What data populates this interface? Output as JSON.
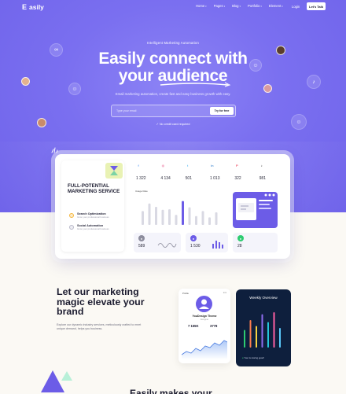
{
  "nav": {
    "logo": "asily",
    "logo_mark": "E",
    "menu": [
      {
        "label": "Home"
      },
      {
        "label": "Pages"
      },
      {
        "label": "Blog"
      },
      {
        "label": "Portfolio"
      },
      {
        "label": "Element"
      }
    ],
    "login": "Login",
    "talk": "Let's Talk"
  },
  "hero": {
    "eyebrow": "Intelligent Marketing Automation",
    "headline_line1": "Easily connect with",
    "headline_line2": "your audience",
    "subtitle": "Email marketing automation, create fast and easy business growth with easy.",
    "email_placeholder": "Type your email",
    "try_button": "Try for free",
    "no_credit": "No credit card required"
  },
  "dashboard": {
    "feature_title": "FULL-POTENTIAL MARKETING SERVICE",
    "features": [
      {
        "title": "Search Optimization",
        "desc": "Grow your professional business",
        "color": "#f6b73c"
      },
      {
        "title": "Social Automation",
        "desc": "Grow your professional business",
        "color": "#b9b9c9"
      }
    ],
    "stats": [
      {
        "icon": "f",
        "value": "1 322",
        "color": "#1877f2"
      },
      {
        "icon": "◎",
        "value": "4 134",
        "color": "#e1306c"
      },
      {
        "icon": "t",
        "value": "501",
        "color": "#1da1f2"
      },
      {
        "icon": "in",
        "value": "1 013",
        "color": "#0a66c2"
      },
      {
        "icon": "P",
        "value": "322",
        "color": "#e60023"
      },
      {
        "icon": "♪",
        "value": "981",
        "color": "#111111"
      }
    ],
    "chart_label": "Usage Rate",
    "chart_values": [
      0.55,
      0.85,
      0.72,
      0.6,
      0.62,
      0.4,
      0.95,
      0.7,
      0.35,
      0.55,
      0.3,
      0.5
    ],
    "highlight_index": 6,
    "minis": [
      {
        "value": "589",
        "color": "#8d8d9d"
      },
      {
        "value": "1 530",
        "color": "#6c5ce7"
      },
      {
        "value": "28",
        "color": "#2ecc71"
      }
    ]
  },
  "section": {
    "heading": "Let our marketing magic elevate your brand",
    "paragraph": "Explore our dynamic industry services, meticulously crafted to meet unique demand, helps you business."
  },
  "profile_card": {
    "top_label": "Profile",
    "name": "YouDesign Theme",
    "role": "Designer",
    "stat1": "7 155K",
    "stat2": "3778"
  },
  "weekly": {
    "title": "Weekly Overview",
    "footer": "Your is storing good!",
    "bars": [
      0.45,
      0.7,
      0.55,
      0.85,
      0.65,
      0.9,
      0.5
    ],
    "colors": [
      "#2ecc71",
      "#ff7f50",
      "#f5d142",
      "#8e6cf0",
      "#26c6da",
      "#ff5fa2",
      "#5ac8fa"
    ]
  },
  "bottom_heading": "Easily makes your"
}
